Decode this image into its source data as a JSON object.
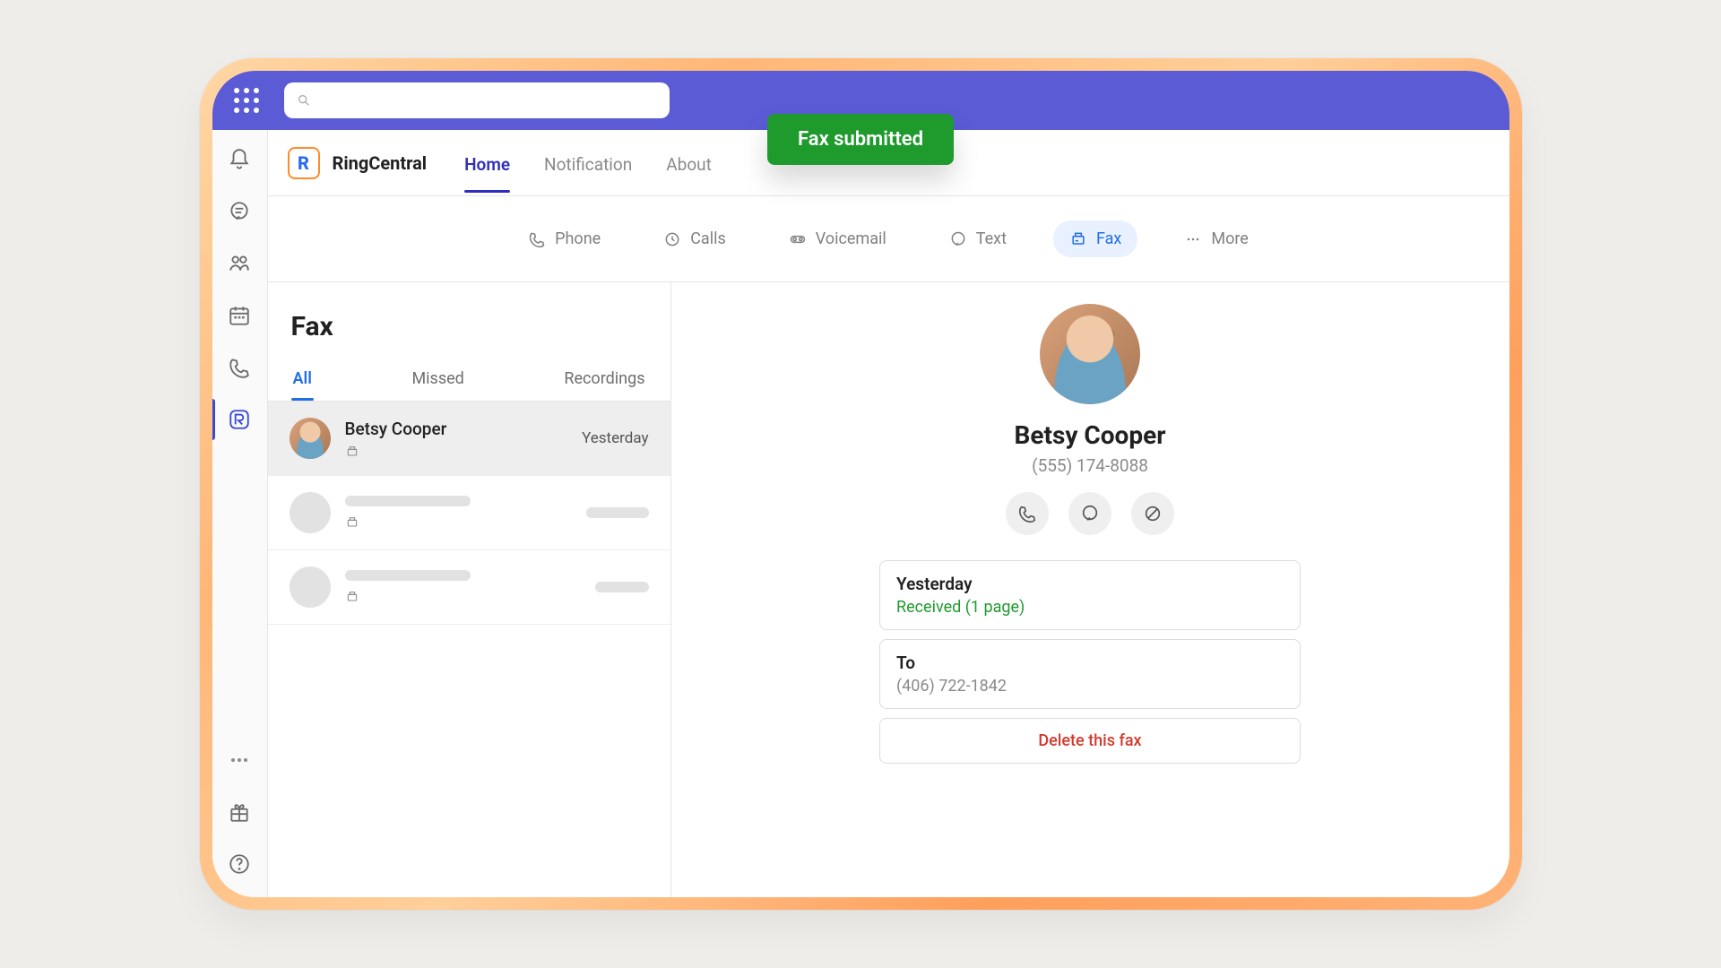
{
  "toast": "Fax submitted",
  "brand": "RingCentral",
  "nav": {
    "home": "Home",
    "notification": "Notification",
    "about": "About"
  },
  "subtabs": {
    "phone": "Phone",
    "calls": "Calls",
    "voicemail": "Voicemail",
    "text": "Text",
    "fax": "Fax",
    "more": "More"
  },
  "list": {
    "title": "Fax",
    "tabs": {
      "all": "All",
      "missed": "Missed",
      "recordings": "Recordings"
    },
    "row1": {
      "name": "Betsy Cooper",
      "time": "Yesterday"
    }
  },
  "detail": {
    "name": "Betsy Cooper",
    "phone": "(555) 174-8088",
    "card1": {
      "label": "Yesterday",
      "sub": "Received (1 page)"
    },
    "card2": {
      "label": "To",
      "sub": "(406) 722-1842"
    },
    "delete": "Delete this fax"
  }
}
